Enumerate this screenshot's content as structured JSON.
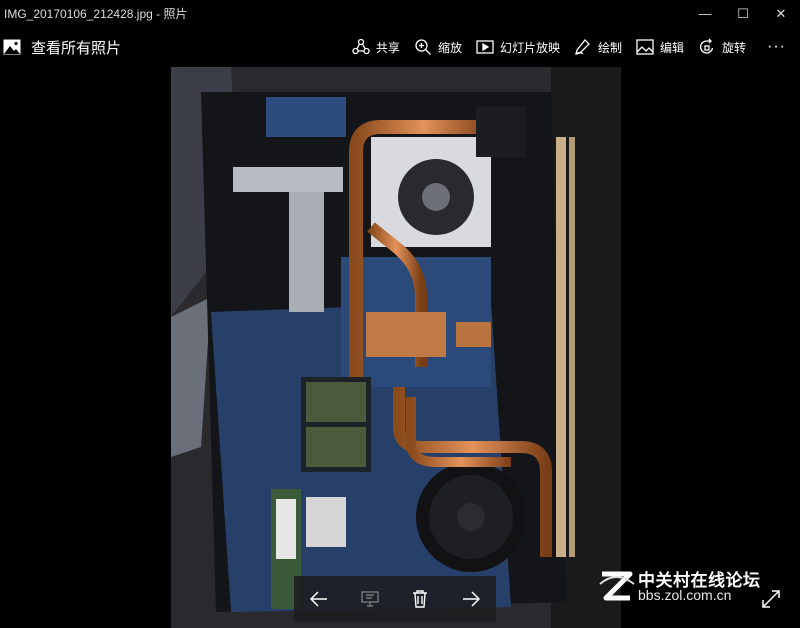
{
  "window": {
    "title": "IMG_20170106_212428.jpg - 照片",
    "minimize_glyph": "—",
    "maximize_glyph": "☐",
    "close_glyph": "✕"
  },
  "toolbar": {
    "back_label": "查看所有照片",
    "back_icon": "photos-app-icon",
    "share_label": "共享",
    "zoom_label": "缩放",
    "slideshow_label": "幻灯片放映",
    "draw_label": "绘制",
    "edit_label": "编辑",
    "rotate_label": "旋转",
    "more_glyph": "···"
  },
  "photo": {
    "description_icon": "laptop-motherboard-photo"
  },
  "navbar": {
    "prev_icon": "arrow-left-icon",
    "slideshow_icon": "present-icon",
    "delete_icon": "trash-icon",
    "next_icon": "arrow-right-icon"
  },
  "watermark": {
    "cn": "中关村在线论坛",
    "url": "bbs.zol.com.cn"
  }
}
